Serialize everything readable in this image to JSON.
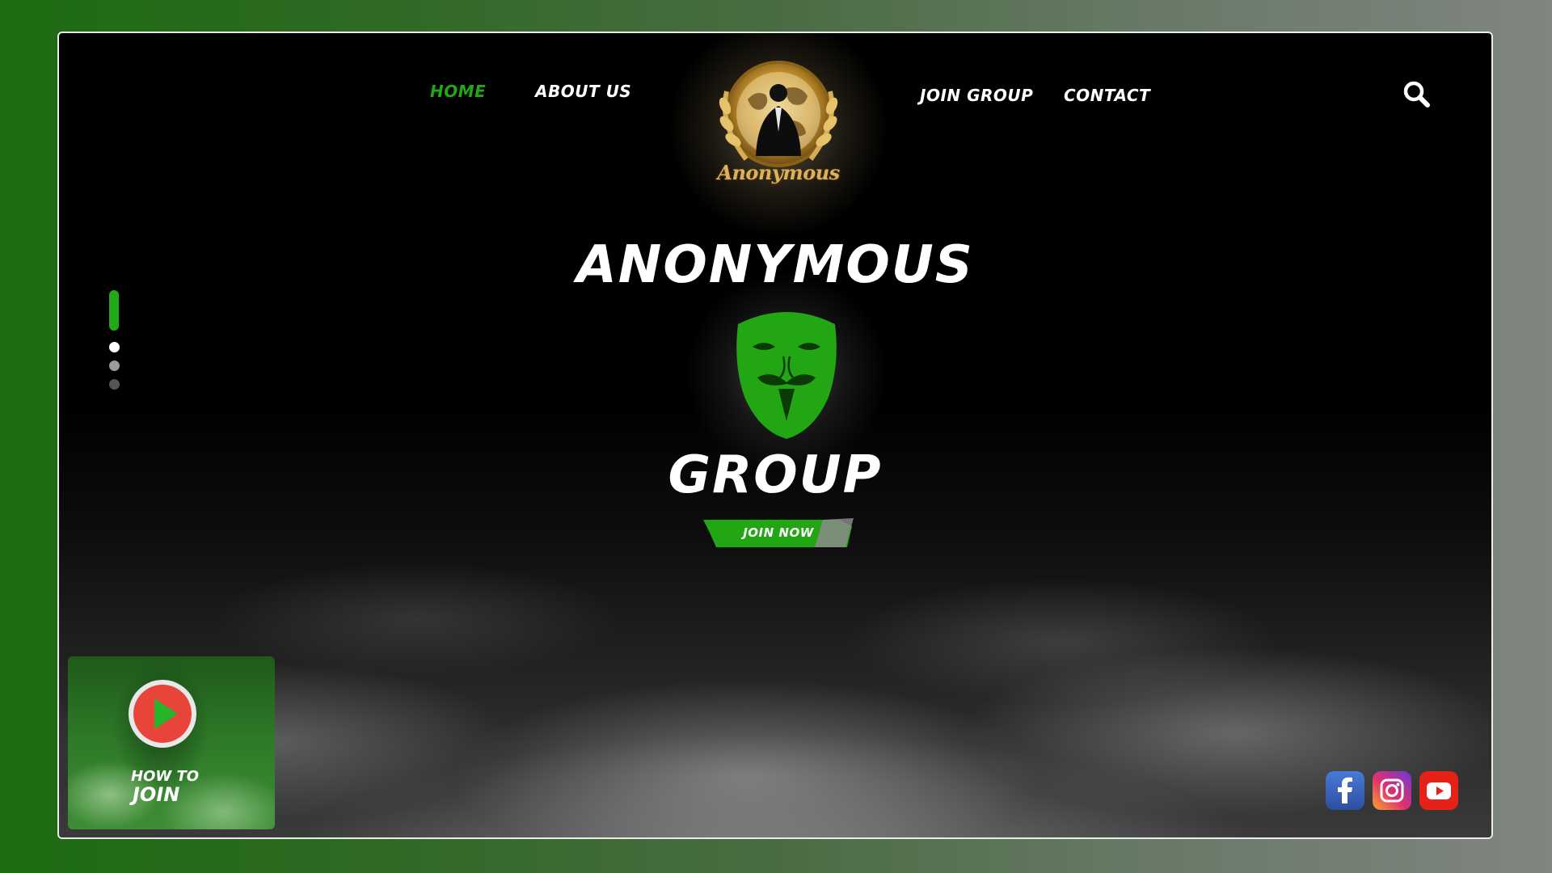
{
  "nav": {
    "home": "HOME",
    "about": "ABOUT US",
    "join_group": "JOIN GROUP",
    "contact": "CONTACT",
    "active_color": "#22a614"
  },
  "logo": {
    "text": "Anonymous",
    "icon": "anonymous-emblem-icon"
  },
  "search": {
    "icon": "search-icon"
  },
  "hero": {
    "title": "ANONYMOUS",
    "subtitle": "GROUP",
    "mask_icon": "guy-fawkes-mask-icon",
    "mask_color": "#22a614",
    "cta_label": "JOIN NOW"
  },
  "slider": {
    "active_color": "#23a81a",
    "dot_colors": [
      "#ffffff",
      "#9a9a9a",
      "#555555"
    ]
  },
  "video": {
    "label_line1": "HOW TO",
    "label_line2": "JOIN",
    "icon": "play-icon"
  },
  "social": [
    {
      "name": "facebook-icon",
      "color": "#3b5998"
    },
    {
      "name": "instagram-icon",
      "color": "#c13584"
    },
    {
      "name": "youtube-icon",
      "color": "#e62117"
    }
  ]
}
